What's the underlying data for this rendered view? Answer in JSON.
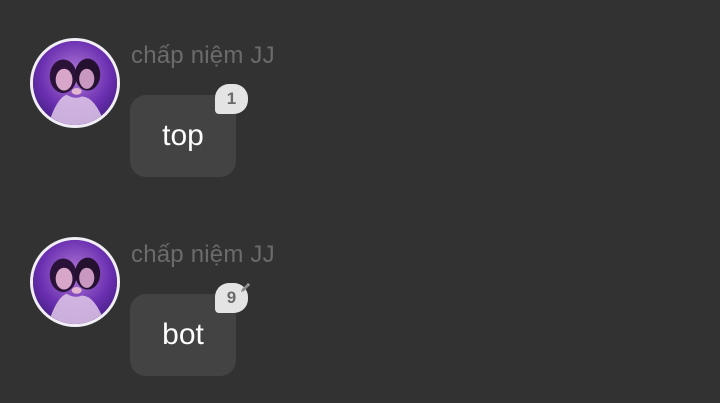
{
  "messages": [
    {
      "sender": "chấp niệm JJ",
      "text": "top",
      "badge": "1",
      "avatar_icon": "profile-photo"
    },
    {
      "sender": "chấp niệm JJ",
      "text": "bot",
      "badge": "9",
      "badge_extra_icon": "pencil-icon",
      "avatar_icon": "profile-photo"
    }
  ],
  "colors": {
    "background": "#323232",
    "bubble": "#434343",
    "badge": "#e4e4e4",
    "sender_text": "#6b6b6b"
  }
}
